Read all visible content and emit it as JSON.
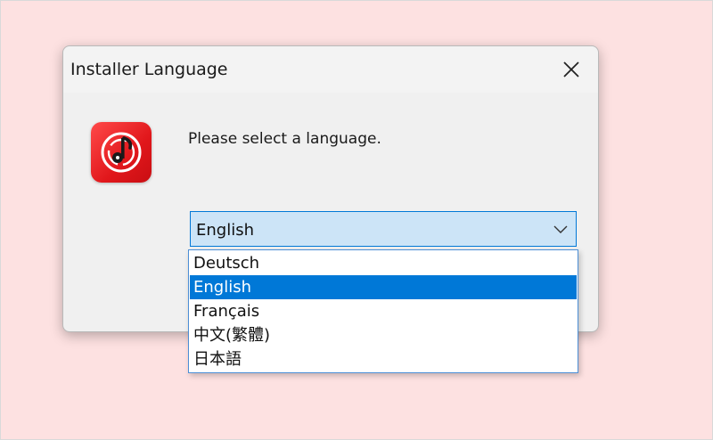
{
  "window": {
    "title": "Installer Language",
    "close_icon": "close-icon"
  },
  "app": {
    "icon": "music-note-icon",
    "icon_color": "#e1171b"
  },
  "prompt": "Please select a language.",
  "language_select": {
    "selected_value": "English",
    "options": [
      {
        "label": "Deutsch",
        "selected": false
      },
      {
        "label": "English",
        "selected": true
      },
      {
        "label": "Français",
        "selected": false
      },
      {
        "label": "中文(繁體)",
        "selected": false
      },
      {
        "label": "日本語",
        "selected": false
      }
    ]
  },
  "colors": {
    "accent": "#0078d7",
    "select_background": "#cce4f7",
    "dialog_background": "#f0f0f0",
    "desktop_background": "#fde1e1"
  }
}
